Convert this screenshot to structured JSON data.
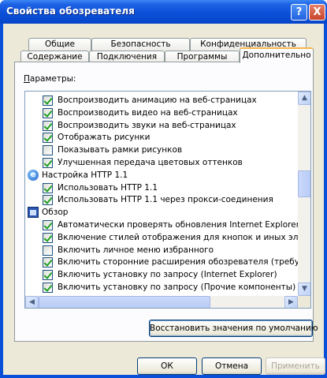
{
  "window": {
    "title": "Свойства обозревателя"
  },
  "titlebar_buttons": {
    "help": "?",
    "close": "X"
  },
  "tabs_back": [
    {
      "label": "Общие"
    },
    {
      "label": "Безопасность"
    },
    {
      "label": "Конфиденциальность"
    }
  ],
  "tabs_front": [
    {
      "label": "Содержание"
    },
    {
      "label": "Подключения"
    },
    {
      "label": "Программы"
    },
    {
      "label": "Дополнительно",
      "active": true
    }
  ],
  "params_label": "Параметры:",
  "settings": [
    {
      "kind": "checkbox",
      "checked": true,
      "label": "Воспроизводить анимацию на веб-страницах"
    },
    {
      "kind": "checkbox",
      "checked": true,
      "label": "Воспроизводить видео на веб-страницах"
    },
    {
      "kind": "checkbox",
      "checked": true,
      "label": "Воспроизводить звуки на веб-страницах"
    },
    {
      "kind": "checkbox",
      "checked": true,
      "label": "Отображать рисунки"
    },
    {
      "kind": "checkbox",
      "checked": false,
      "label": "Показывать рамки рисунков"
    },
    {
      "kind": "checkbox",
      "checked": true,
      "label": "Улучшенная передача цветовых оттенков"
    },
    {
      "kind": "group",
      "icon": "internet-explorer-icon",
      "label": "Настройка HTTP 1.1"
    },
    {
      "kind": "checkbox",
      "checked": true,
      "label": "Использовать HTTP 1.1"
    },
    {
      "kind": "checkbox",
      "checked": true,
      "label": "Использовать HTTP 1.1 через прокси-соединения"
    },
    {
      "kind": "group",
      "icon": "browse-window-icon",
      "label": "Обзор"
    },
    {
      "kind": "checkbox",
      "checked": true,
      "label": "Автоматически проверять обновления Internet Explorer."
    },
    {
      "kind": "checkbox",
      "checked": true,
      "label": "Включение стилей отображения для кнопок и иных элемент"
    },
    {
      "kind": "checkbox",
      "checked": false,
      "label": "Включить личное меню избранного"
    },
    {
      "kind": "checkbox",
      "checked": true,
      "label": "Включить сторонние расширения обозревателя (требуется"
    },
    {
      "kind": "checkbox",
      "checked": true,
      "label": "Включить установку по запросу (Internet Explorer)"
    },
    {
      "kind": "checkbox",
      "checked": true,
      "label": "Включить установку по запросу (Прочие компоненты)"
    }
  ],
  "scroll": {
    "up": "▲",
    "down": "▼",
    "left": "◀",
    "right": "▶"
  },
  "buttons": {
    "restore_defaults": "Восстановить значения по умолчанию",
    "ok": "ОК",
    "cancel": "Отмена",
    "apply": "Применить"
  }
}
